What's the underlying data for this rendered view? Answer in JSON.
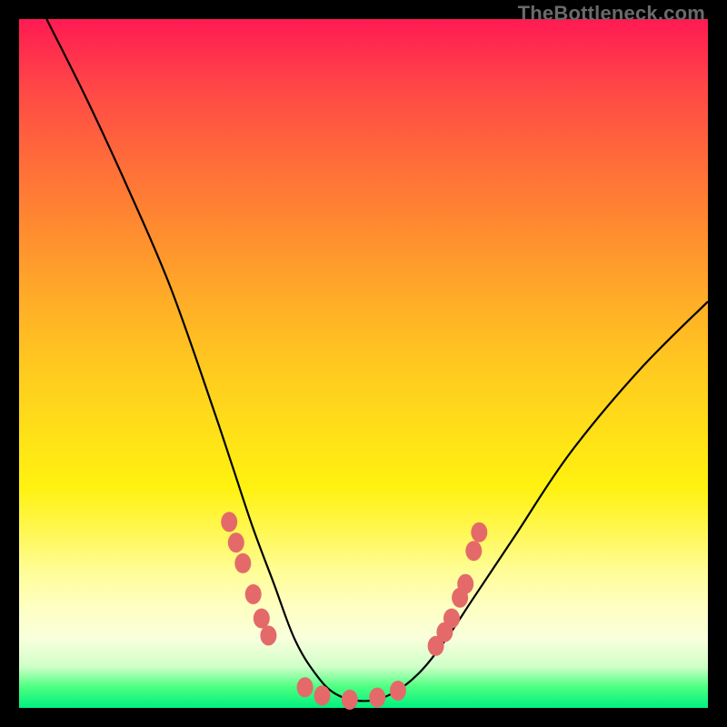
{
  "watermark": "TheBottleneck.com",
  "colors": {
    "marker": "#e46a6a",
    "curve": "#000000"
  },
  "chart_data": {
    "type": "line",
    "title": "",
    "xlabel": "",
    "ylabel": "",
    "xlim": [
      0,
      100
    ],
    "ylim": [
      0,
      100
    ],
    "grid": false,
    "note": "Bottleneck-style V-curve. x is approximate horizontal position (% of plot width), y is approximate height (% of plot height, 0 = bottom). Values estimated from pixels; chart has no numeric axes.",
    "series": [
      {
        "name": "bottleneck-curve",
        "x": [
          4,
          10,
          16,
          22,
          28,
          31,
          34,
          37,
          40,
          43,
          46,
          50,
          54,
          58,
          62,
          66,
          72,
          80,
          90,
          100
        ],
        "y": [
          100,
          88,
          75,
          61,
          44,
          35,
          26,
          18,
          10,
          5,
          2,
          1,
          2,
          5,
          10,
          16,
          25,
          37,
          49,
          59
        ]
      }
    ],
    "markers": {
      "note": "Salmon-colored beads clustered near the valley; positions approximate (% of plot width/height).",
      "points": [
        {
          "x": 30.5,
          "y": 27.0
        },
        {
          "x": 31.5,
          "y": 24.0
        },
        {
          "x": 32.5,
          "y": 21.0
        },
        {
          "x": 34.0,
          "y": 16.5
        },
        {
          "x": 35.2,
          "y": 13.0
        },
        {
          "x": 36.2,
          "y": 10.5
        },
        {
          "x": 41.5,
          "y": 3.0
        },
        {
          "x": 44.0,
          "y": 1.8
        },
        {
          "x": 48.0,
          "y": 1.2
        },
        {
          "x": 52.0,
          "y": 1.5
        },
        {
          "x": 55.0,
          "y": 2.5
        },
        {
          "x": 60.5,
          "y": 9.0
        },
        {
          "x": 61.8,
          "y": 11.0
        },
        {
          "x": 62.8,
          "y": 13.0
        },
        {
          "x": 64.0,
          "y": 16.0
        },
        {
          "x": 64.8,
          "y": 18.0
        },
        {
          "x": 66.0,
          "y": 22.8
        },
        {
          "x": 66.8,
          "y": 25.5
        }
      ]
    }
  }
}
